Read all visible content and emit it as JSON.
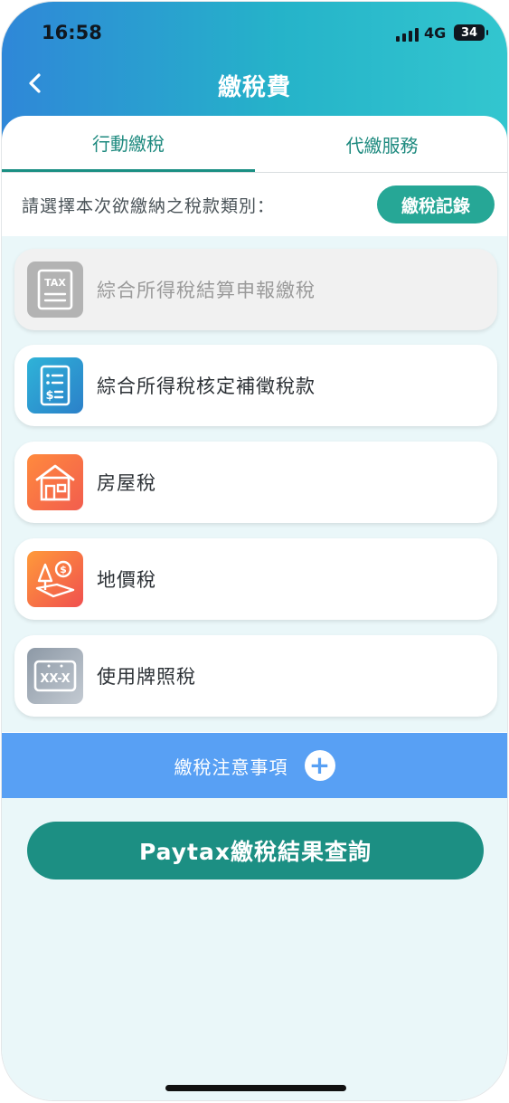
{
  "status_bar": {
    "time": "16:58",
    "network": "4G",
    "battery": "34"
  },
  "header": {
    "title": "繳稅費",
    "back_icon": "chevron-left-icon"
  },
  "tabs": [
    {
      "label": "行動繳稅",
      "active": true
    },
    {
      "label": "代繳服務",
      "active": false
    }
  ],
  "prompt": {
    "text": "請選擇本次欲繳納之稅款類別：",
    "records_button": "繳稅記錄"
  },
  "tax_items": [
    {
      "label": "綜合所得稅結算申報繳稅",
      "icon": "tax-document-icon",
      "enabled": false
    },
    {
      "label": "綜合所得稅核定補徵稅款",
      "icon": "tax-bill-icon",
      "enabled": true
    },
    {
      "label": "房屋稅",
      "icon": "house-icon",
      "enabled": true
    },
    {
      "label": "地價稅",
      "icon": "land-value-icon",
      "enabled": true
    },
    {
      "label": "使用牌照稅",
      "icon": "license-plate-icon",
      "enabled": true
    }
  ],
  "notice": {
    "label": "繳稅注意事項",
    "icon": "plus-icon"
  },
  "paytax_button": "Paytax繳稅結果查詢",
  "colors": {
    "header_gradient_start": "#2f87d8",
    "header_gradient_end": "#33c6cf",
    "accent_teal": "#1c8f83",
    "notice_blue": "#58a0f4",
    "list_background": "#eaf7f9"
  }
}
